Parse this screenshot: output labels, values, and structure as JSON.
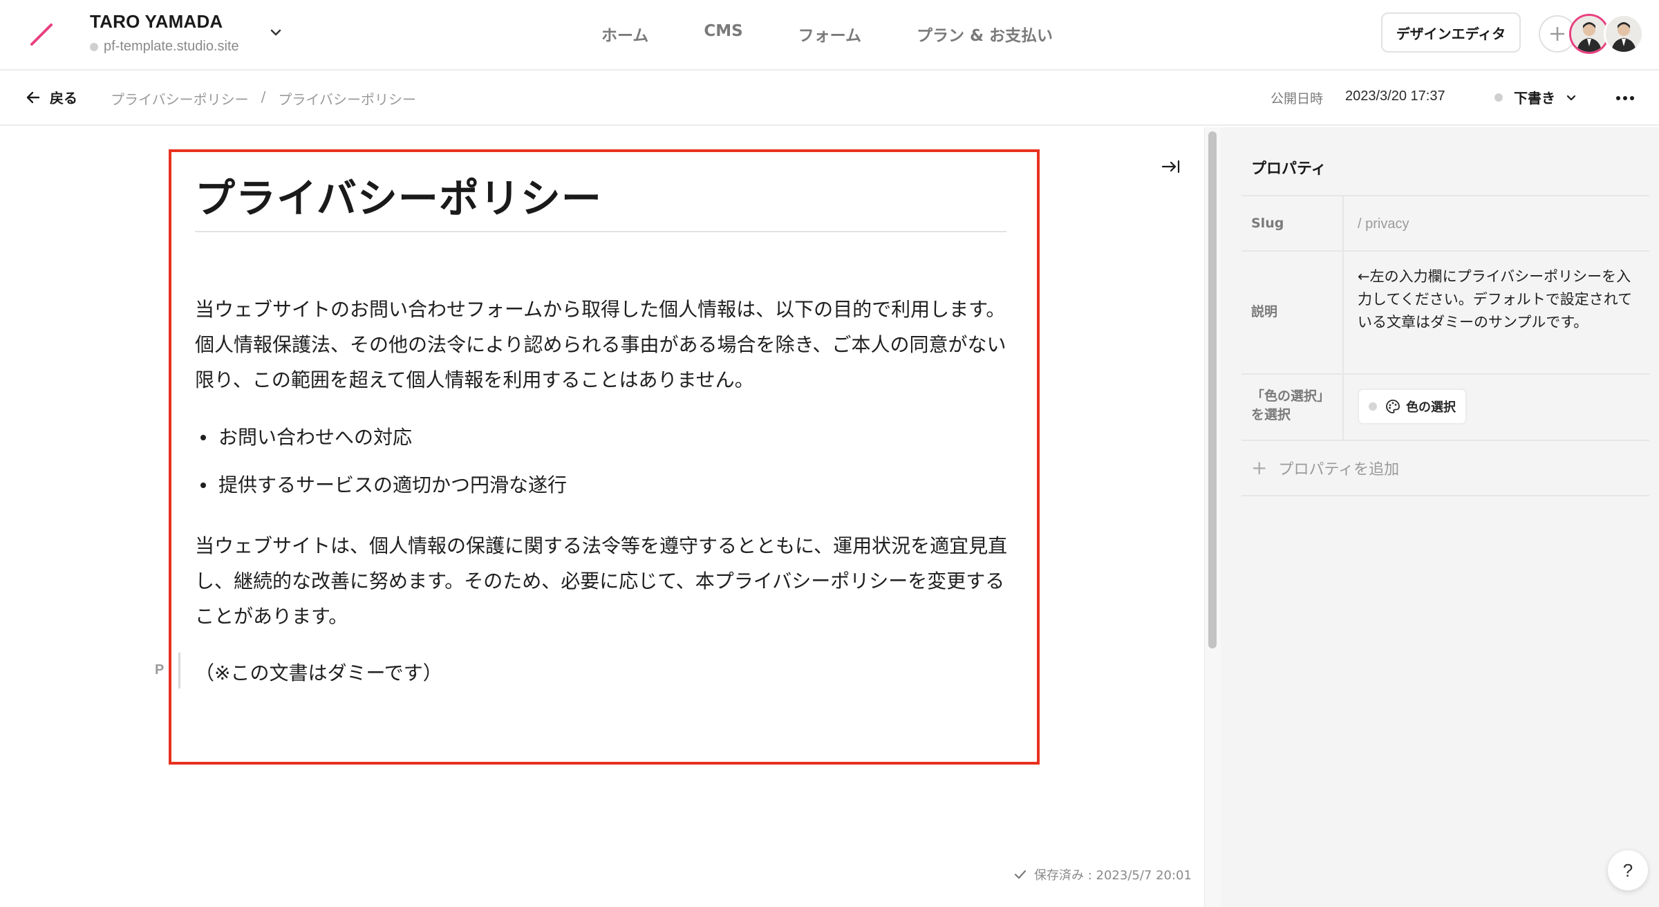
{
  "header": {
    "site_name": "TARO YAMADA",
    "site_url": "pf-template.studio.site",
    "nav": [
      {
        "label": "ホーム"
      },
      {
        "label": "CMS"
      },
      {
        "label": "フォーム"
      },
      {
        "label": "プラン & お支払い"
      }
    ],
    "design_editor_label": "デザインエディタ",
    "accent_color": "#e8407f"
  },
  "subbar": {
    "back_label": "戻る",
    "breadcrumbs": [
      "プライバシーポリシー",
      "プライバシーポリシー"
    ],
    "breadcrumb_separator": "/",
    "publish_label": "公開日時",
    "publish_date": "2023/3/20 17:37",
    "status": "下書き"
  },
  "document": {
    "title": "プライバシーポリシー",
    "paragraph1": "当ウェブサイトのお問い合わせフォームから取得した個人情報は、以下の目的で利用します。個人情報保護法、その他の法令により認められる事由がある場合を除き、ご本人の同意がない限り、この範囲を超えて個人情報を利用することはありません。",
    "bullets": [
      "お問い合わせへの対応",
      "提供するサービスの適切かつ円滑な遂行"
    ],
    "paragraph2": "当ウェブサイトは、個人情報の保護に関する法令等を遵守するとともに、運用状況を適宜見直し、継続的な改善に努めます。そのため、必要に応じて、本プライバシーポリシーを変更することがあります。",
    "block_type_label": "P",
    "paragraph3": "（※この文書はダミーです）",
    "saved_status": "保存済み : 2023/5/7 20:01",
    "highlight_color": "#e8311f"
  },
  "properties": {
    "title": "プロパティ",
    "slug_key": "Slug",
    "slug_value": "/ privacy",
    "description_key": "説明",
    "description_value": "←左の入力欄にプライバシーポリシーを入力してください。デフォルトで設定されている文章はダミーのサンプルです。",
    "color_key": "「色の選択」を選択",
    "color_button_label": "色の選択",
    "add_property_label": "プロパティを追加"
  },
  "help_label": "?"
}
